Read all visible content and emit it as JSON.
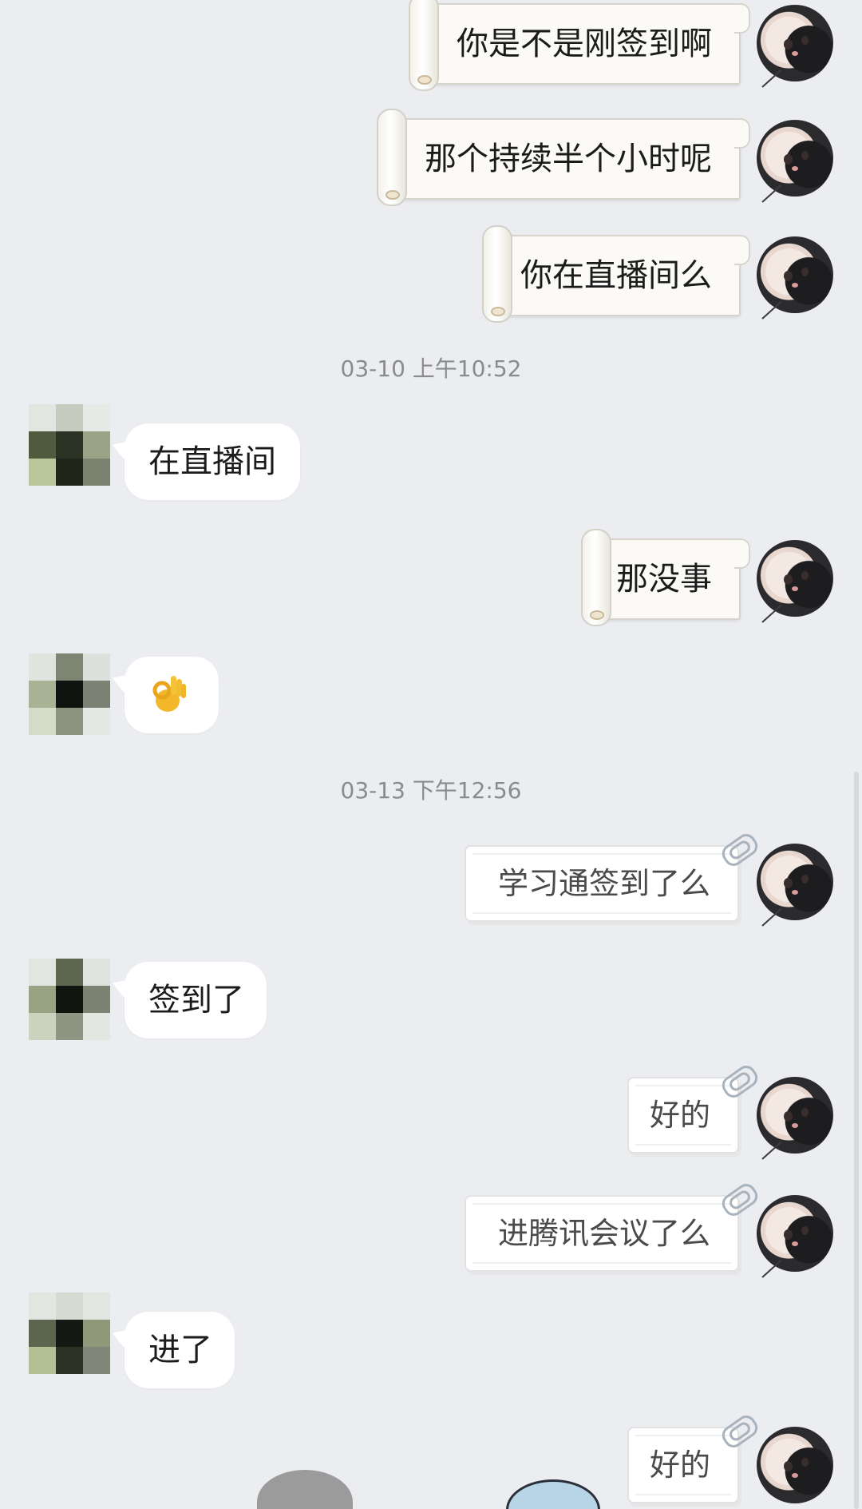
{
  "colors": {
    "background": "#ecedf1",
    "timestamp_text": "#8a8b90",
    "bubble_white": "#ffffff",
    "scroll_paper": "#fbfaf6",
    "text_dark": "#1b1b1b",
    "text_clip": "#4a4a4a"
  },
  "timestamps": {
    "t1": "03-10 上午10:52",
    "t2": "03-13 下午12:56"
  },
  "messages": {
    "m1": "你是不是刚签到啊",
    "m2": "那个持续半个小时呢",
    "m3": "你在直播间么",
    "m4": "在直播间",
    "m5": "那没事",
    "m7": "学习通签到了么",
    "m8": "签到了",
    "m9": "好的",
    "m10": "进腾讯会议了么",
    "m11": "进了",
    "m12": "好的"
  },
  "icons": {
    "my_avatar": "white-cat-avatar",
    "other_avatar": "pixelated-avatar",
    "ok_emoji": "ok-hand-emoji",
    "paper_clip": "paper-clip-icon",
    "scroll_roll": "scroll-roll-icon"
  }
}
